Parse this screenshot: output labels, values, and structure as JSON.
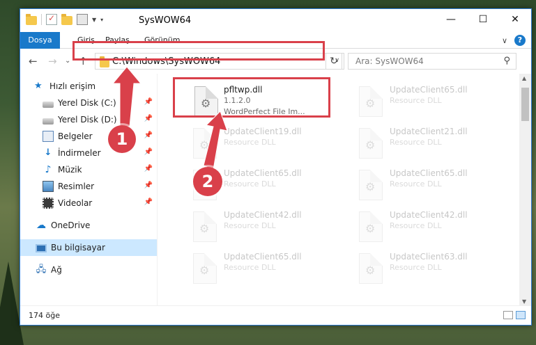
{
  "window": {
    "title": "SysWOW64"
  },
  "window_controls": {
    "minimize": "—",
    "maximize": "☐",
    "close": "✕"
  },
  "ribbon": {
    "tabs": [
      "Dosya",
      "Giriş",
      "Paylaş",
      "Görünüm"
    ],
    "collapse": "∨",
    "help": "?"
  },
  "nav": {
    "back": "←",
    "forward": "→",
    "recent": "⌄",
    "up": "↑",
    "address": "C:\\Windows\\SysWOW64",
    "address_dropdown": "∨",
    "refresh": "↻",
    "search_placeholder": "Ara: SysWOW64",
    "search_icon": "⚲"
  },
  "sidebar": {
    "items": [
      {
        "label": "Hızlı erişim",
        "icon": "star-icon",
        "pinned": false
      },
      {
        "label": "Yerel Disk (C:)",
        "icon": "drive-icon",
        "pinned": true
      },
      {
        "label": "Yerel Disk (D:)",
        "icon": "drive-icon",
        "pinned": true
      },
      {
        "label": "Belgeler",
        "icon": "documents-icon",
        "pinned": true
      },
      {
        "label": "İndirmeler",
        "icon": "download-icon",
        "pinned": true
      },
      {
        "label": "Müzik",
        "icon": "music-icon",
        "pinned": true
      },
      {
        "label": "Resimler",
        "icon": "pictures-icon",
        "pinned": true
      },
      {
        "label": "Videolar",
        "icon": "video-icon",
        "pinned": true
      },
      {
        "label": "OneDrive",
        "icon": "cloud-icon",
        "pinned": false
      },
      {
        "label": "Bu bilgisayar",
        "icon": "computer-icon",
        "pinned": false,
        "selected": true
      },
      {
        "label": "Ağ",
        "icon": "network-icon",
        "pinned": false
      }
    ],
    "pin_glyph": "📌"
  },
  "files": [
    {
      "name": "pfltwp.dll",
      "line2": "1.1.2.0",
      "line3": "WordPerfect File Im...",
      "highlighted": true
    },
    {
      "name": "UpdateClient65.dll",
      "line2": "Resource DLL",
      "line3": ""
    },
    {
      "name": "UpdateClient19.dll",
      "line2": "Resource DLL",
      "line3": ""
    },
    {
      "name": "UpdateClient21.dll",
      "line2": "Resource DLL",
      "line3": ""
    },
    {
      "name": "UpdateClient65.dll",
      "line2": "Resource DLL",
      "line3": ""
    },
    {
      "name": "UpdateClient65.dll",
      "line2": "Resource DLL",
      "line3": ""
    },
    {
      "name": "UpdateClient42.dll",
      "line2": "Resource DLL",
      "line3": ""
    },
    {
      "name": "UpdateClient42.dll",
      "line2": "Resource DLL",
      "line3": ""
    },
    {
      "name": "UpdateClient65.dll",
      "line2": "Resource DLL",
      "line3": ""
    },
    {
      "name": "UpdateClient63.dll",
      "line2": "Resource DLL",
      "line3": ""
    }
  ],
  "status": {
    "item_count": "174 öğe"
  },
  "callouts": [
    "1",
    "2"
  ],
  "colors": {
    "accent": "#1979ca",
    "highlight": "#d9404a",
    "selected": "#cce8ff"
  }
}
